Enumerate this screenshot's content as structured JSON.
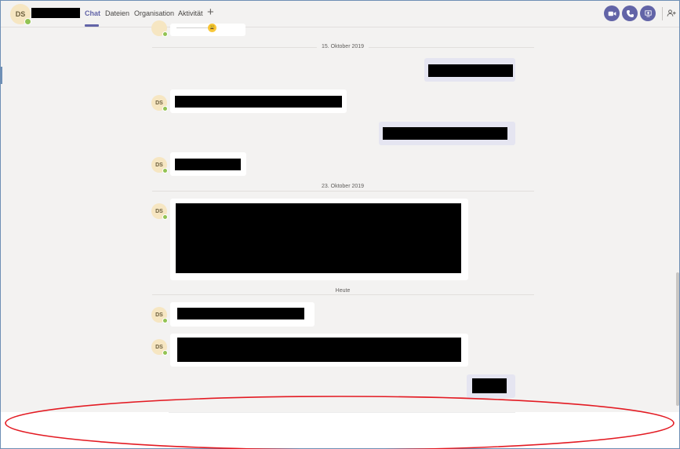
{
  "header": {
    "avatar_initials": "DS",
    "tabs": [
      {
        "label": "Chat",
        "active": true
      },
      {
        "label": "Dateien",
        "active": false
      },
      {
        "label": "Organisation",
        "active": false
      },
      {
        "label": "Aktivität",
        "active": false
      }
    ],
    "add_tab_symbol": "+",
    "icons": [
      "video-call-icon",
      "audio-call-icon",
      "share-screen-icon",
      "add-people-icon"
    ],
    "accent_color": "#6264a7"
  },
  "chat": {
    "dates": [
      "15. Oktober 2019",
      "23. Oktober 2019",
      "Heute"
    ],
    "sender_initials": "DS",
    "snippets": {
      "top_message": "---------------------",
      "top_emoji": "😩"
    }
  },
  "annotation": {
    "ellipse_color": "#e31b23"
  }
}
